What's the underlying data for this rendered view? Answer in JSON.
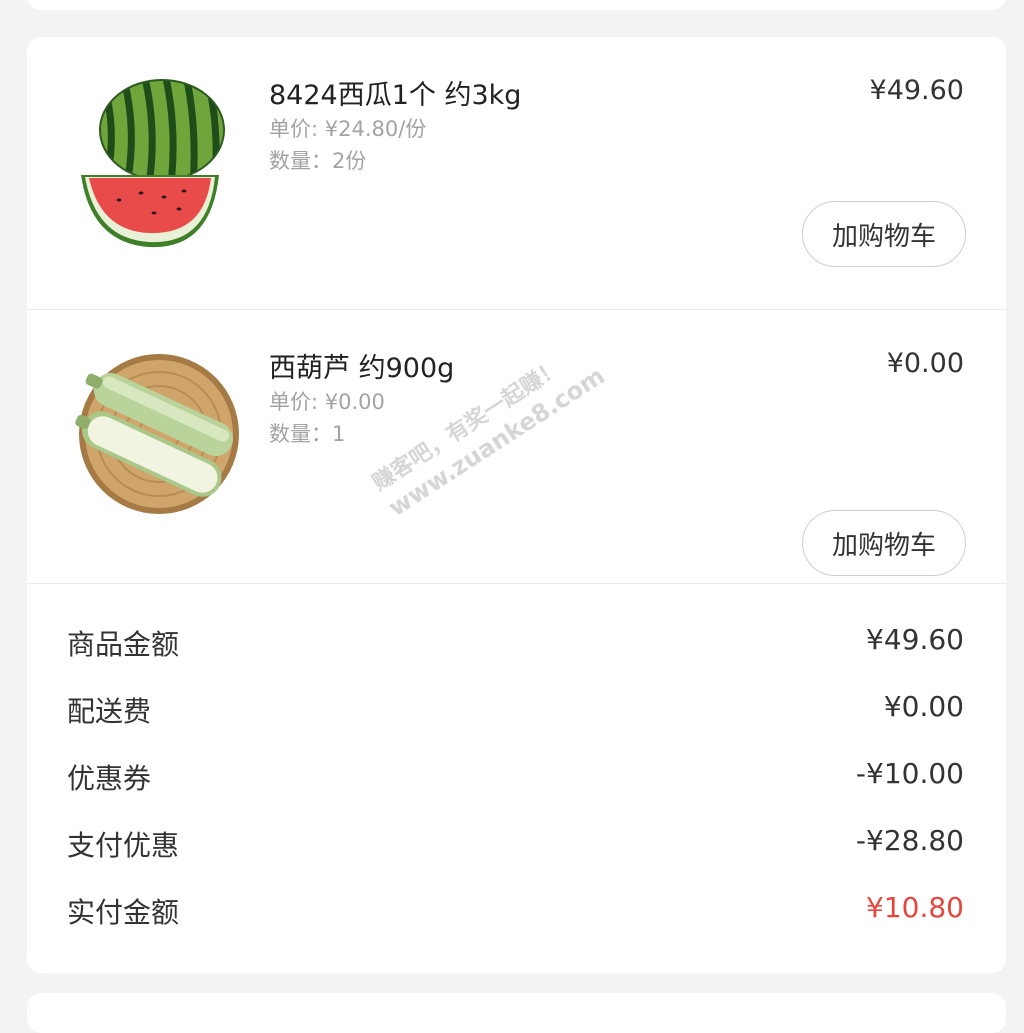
{
  "items": [
    {
      "name": "8424西瓜1个 约3kg",
      "unit_price": "单价: ¥24.80/份",
      "quantity": "数量：2份",
      "price": "¥49.60",
      "cart_button": "加购物车",
      "image_icon": "watermelon-image"
    },
    {
      "name": "西葫芦 约900g",
      "unit_price": "单价: ¥0.00",
      "quantity": "数量：1",
      "price": "¥0.00",
      "cart_button": "加购物车",
      "image_icon": "zucchini-image"
    }
  ],
  "summary": [
    {
      "label": "商品金额",
      "value": "¥49.60"
    },
    {
      "label": "配送费",
      "value": "¥0.00"
    },
    {
      "label": "优惠券",
      "value": "-¥10.00"
    },
    {
      "label": "支付优惠",
      "value": "-¥28.80"
    },
    {
      "label": "实付金额",
      "value": "¥10.80"
    }
  ],
  "watermark": {
    "line1": "赚客吧，有奖一起赚！",
    "line2": "www.zuanke8.com"
  },
  "colors": {
    "accent": "#e5473f",
    "background": "#f3f3f3",
    "card": "#ffffff",
    "muted_text": "#a3a3a3"
  }
}
